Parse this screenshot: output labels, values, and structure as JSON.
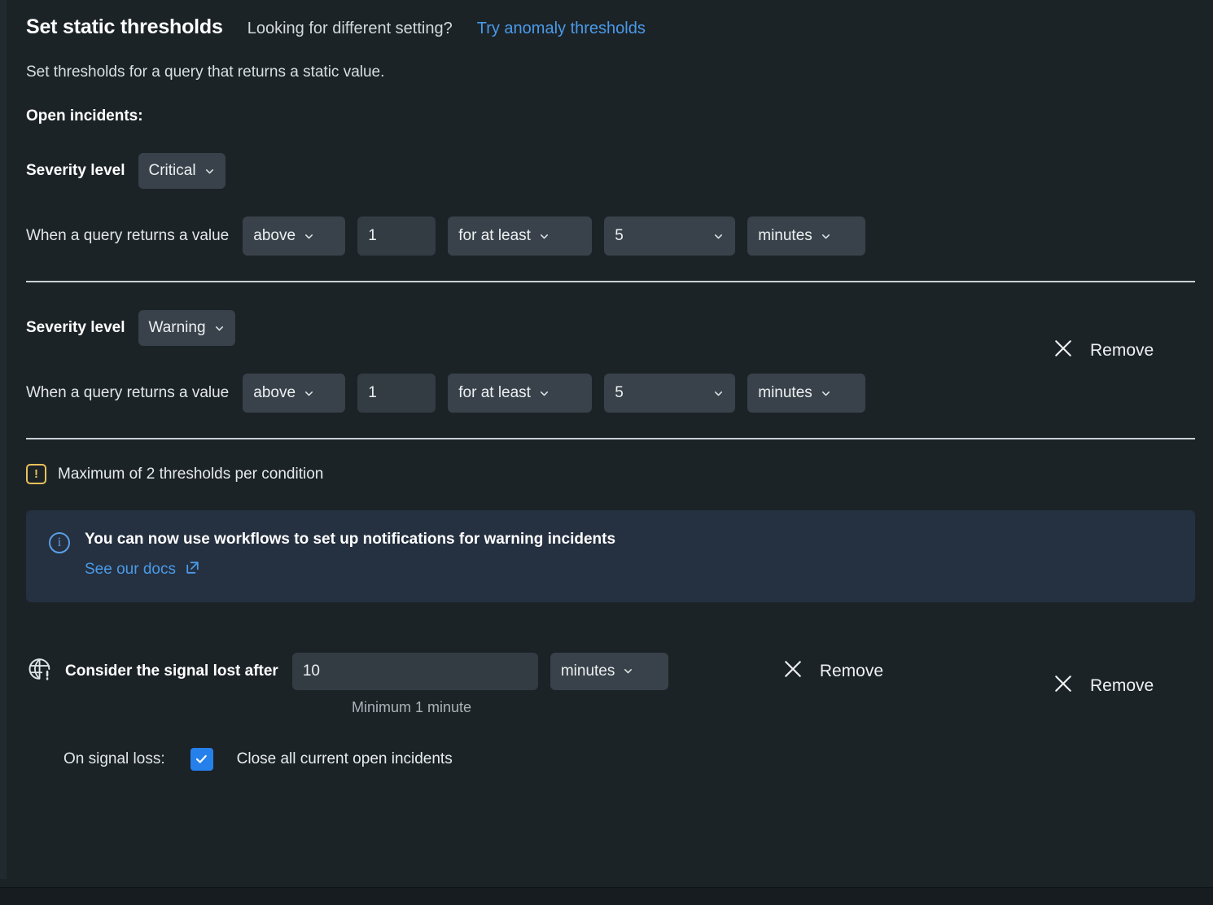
{
  "header": {
    "title": "Set static thresholds",
    "prompt": "Looking for different setting?",
    "link_label": "Try anomaly thresholds",
    "description": "Set thresholds for a query that returns a static value.",
    "section_label": "Open incidents:"
  },
  "thresholds": [
    {
      "severity_label": "Severity level",
      "severity_value": "Critical",
      "remove_label": "Remove",
      "query_label": "When a query returns a value",
      "comparator": "above",
      "value": "1",
      "duration_prefix": "for at least",
      "duration_value": "5",
      "duration_unit": "minutes"
    },
    {
      "severity_label": "Severity level",
      "severity_value": "Warning",
      "remove_label": "Remove",
      "query_label": "When a query returns a value",
      "comparator": "above",
      "value": "1",
      "duration_prefix": "for at least",
      "duration_value": "5",
      "duration_unit": "minutes"
    }
  ],
  "max_note": {
    "icon": "warning-triangle-icon",
    "text": "Maximum of 2 thresholds per condition"
  },
  "banner": {
    "icon": "info-circle-icon",
    "title": "You can now use workflows to set up notifications for warning incidents",
    "link_label": "See our docs",
    "link_icon": "external-link-icon"
  },
  "signal_loss": {
    "icon": "globe-alert-icon",
    "label": "Consider the signal lost after",
    "value": "10",
    "unit": "minutes",
    "hint": "Minimum 1 minute",
    "remove_label": "Remove",
    "on_loss_label": "On signal loss:",
    "checkbox_checked": true,
    "checkbox_label": "Close all current open incidents"
  },
  "colors": {
    "page_background": "#1c2327",
    "control_background": "#39424a",
    "input_background": "#333c43",
    "link": "#4a9ae8",
    "banner_background": "#253040",
    "warning": "#e8c15b",
    "checkbox_accent": "#2680eb",
    "divider": "#c9d1d6"
  }
}
